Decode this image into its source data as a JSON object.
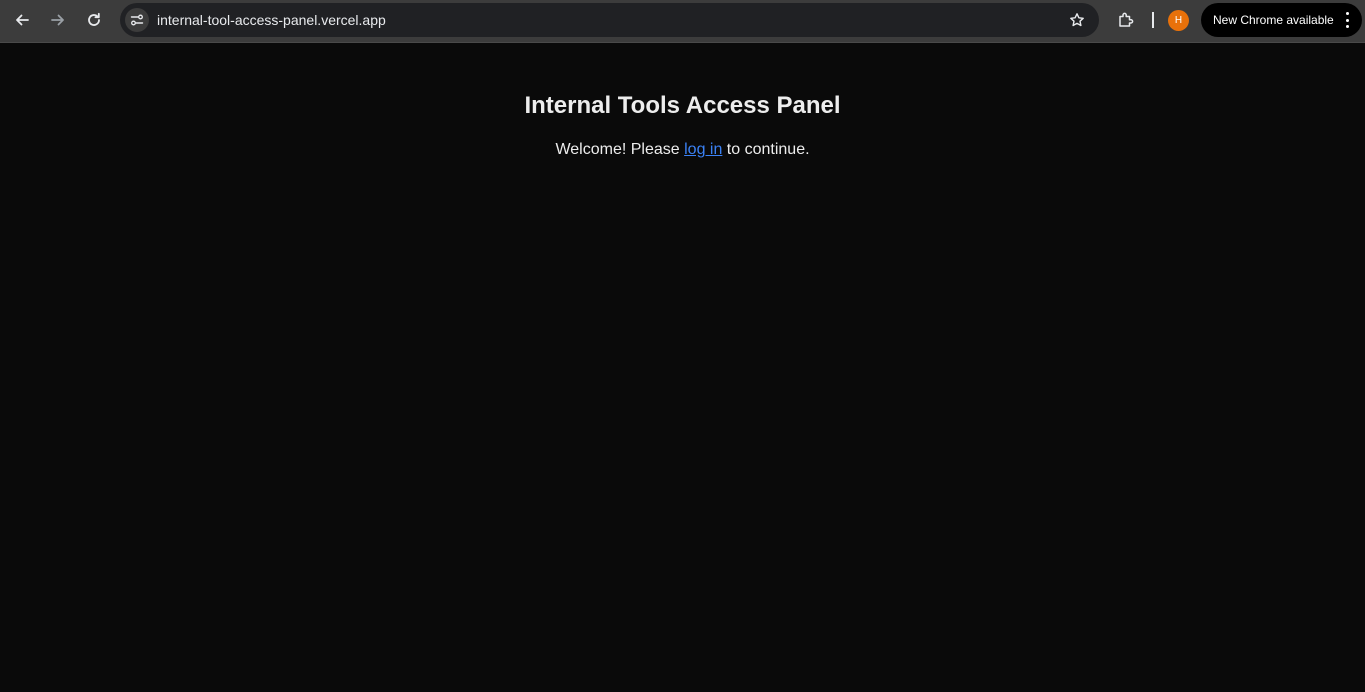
{
  "browser": {
    "url": "internal-tool-access-panel.vercel.app",
    "avatar_initial": "H",
    "update_label": "New Chrome available",
    "colors": {
      "toolbar": "#3c3c3c",
      "omnibox": "#202124",
      "avatar": "#e8710a"
    },
    "icons": [
      "back-arrow-icon",
      "forward-arrow-icon",
      "reload-icon",
      "site-info-icon",
      "bookmark-star-icon",
      "extensions-icon",
      "more-menu-icon"
    ]
  },
  "page": {
    "title": "Internal Tools Access Panel",
    "welcome_before": "Welcome! Please ",
    "login_link": "log in",
    "welcome_after": " to continue.",
    "colors": {
      "background": "#0a0a0a",
      "text": "#ededed",
      "link": "#3b82f6"
    }
  }
}
